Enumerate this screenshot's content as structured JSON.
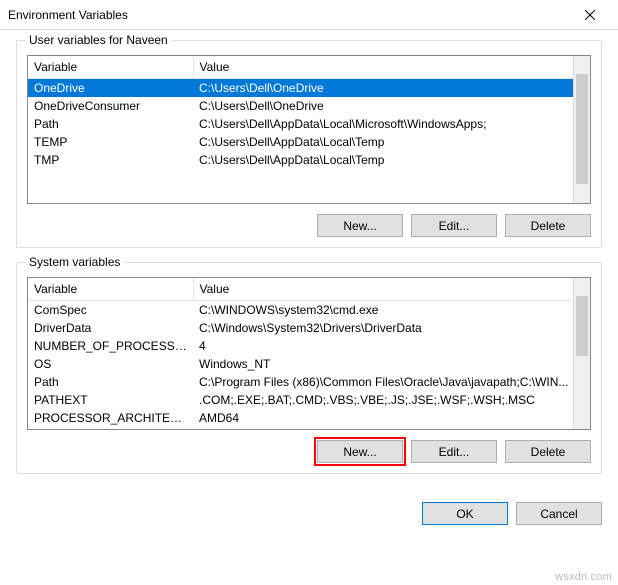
{
  "titlebar": {
    "title": "Environment Variables"
  },
  "user_group": {
    "label": "User variables for Naveen",
    "columns": {
      "variable": "Variable",
      "value": "Value"
    },
    "rows": [
      {
        "variable": "OneDrive",
        "value": "C:\\Users\\Dell\\OneDrive",
        "selected": true
      },
      {
        "variable": "OneDriveConsumer",
        "value": "C:\\Users\\Dell\\OneDrive"
      },
      {
        "variable": "Path",
        "value": "C:\\Users\\Dell\\AppData\\Local\\Microsoft\\WindowsApps;"
      },
      {
        "variable": "TEMP",
        "value": "C:\\Users\\Dell\\AppData\\Local\\Temp"
      },
      {
        "variable": "TMP",
        "value": "C:\\Users\\Dell\\AppData\\Local\\Temp"
      }
    ],
    "buttons": {
      "new": "New...",
      "edit": "Edit...",
      "delete": "Delete"
    }
  },
  "system_group": {
    "label": "System variables",
    "columns": {
      "variable": "Variable",
      "value": "Value"
    },
    "rows": [
      {
        "variable": "ComSpec",
        "value": "C:\\WINDOWS\\system32\\cmd.exe"
      },
      {
        "variable": "DriverData",
        "value": "C:\\Windows\\System32\\Drivers\\DriverData"
      },
      {
        "variable": "NUMBER_OF_PROCESSORS",
        "value": "4"
      },
      {
        "variable": "OS",
        "value": "Windows_NT"
      },
      {
        "variable": "Path",
        "value": "C:\\Program Files (x86)\\Common Files\\Oracle\\Java\\javapath;C:\\WIN..."
      },
      {
        "variable": "PATHEXT",
        "value": ".COM;.EXE;.BAT;.CMD;.VBS;.VBE;.JS;.JSE;.WSF;.WSH;.MSC"
      },
      {
        "variable": "PROCESSOR_ARCHITECTURE",
        "value": "AMD64"
      }
    ],
    "buttons": {
      "new": "New...",
      "edit": "Edit...",
      "delete": "Delete"
    }
  },
  "footer": {
    "ok": "OK",
    "cancel": "Cancel"
  },
  "watermark": "wsxdn.com"
}
